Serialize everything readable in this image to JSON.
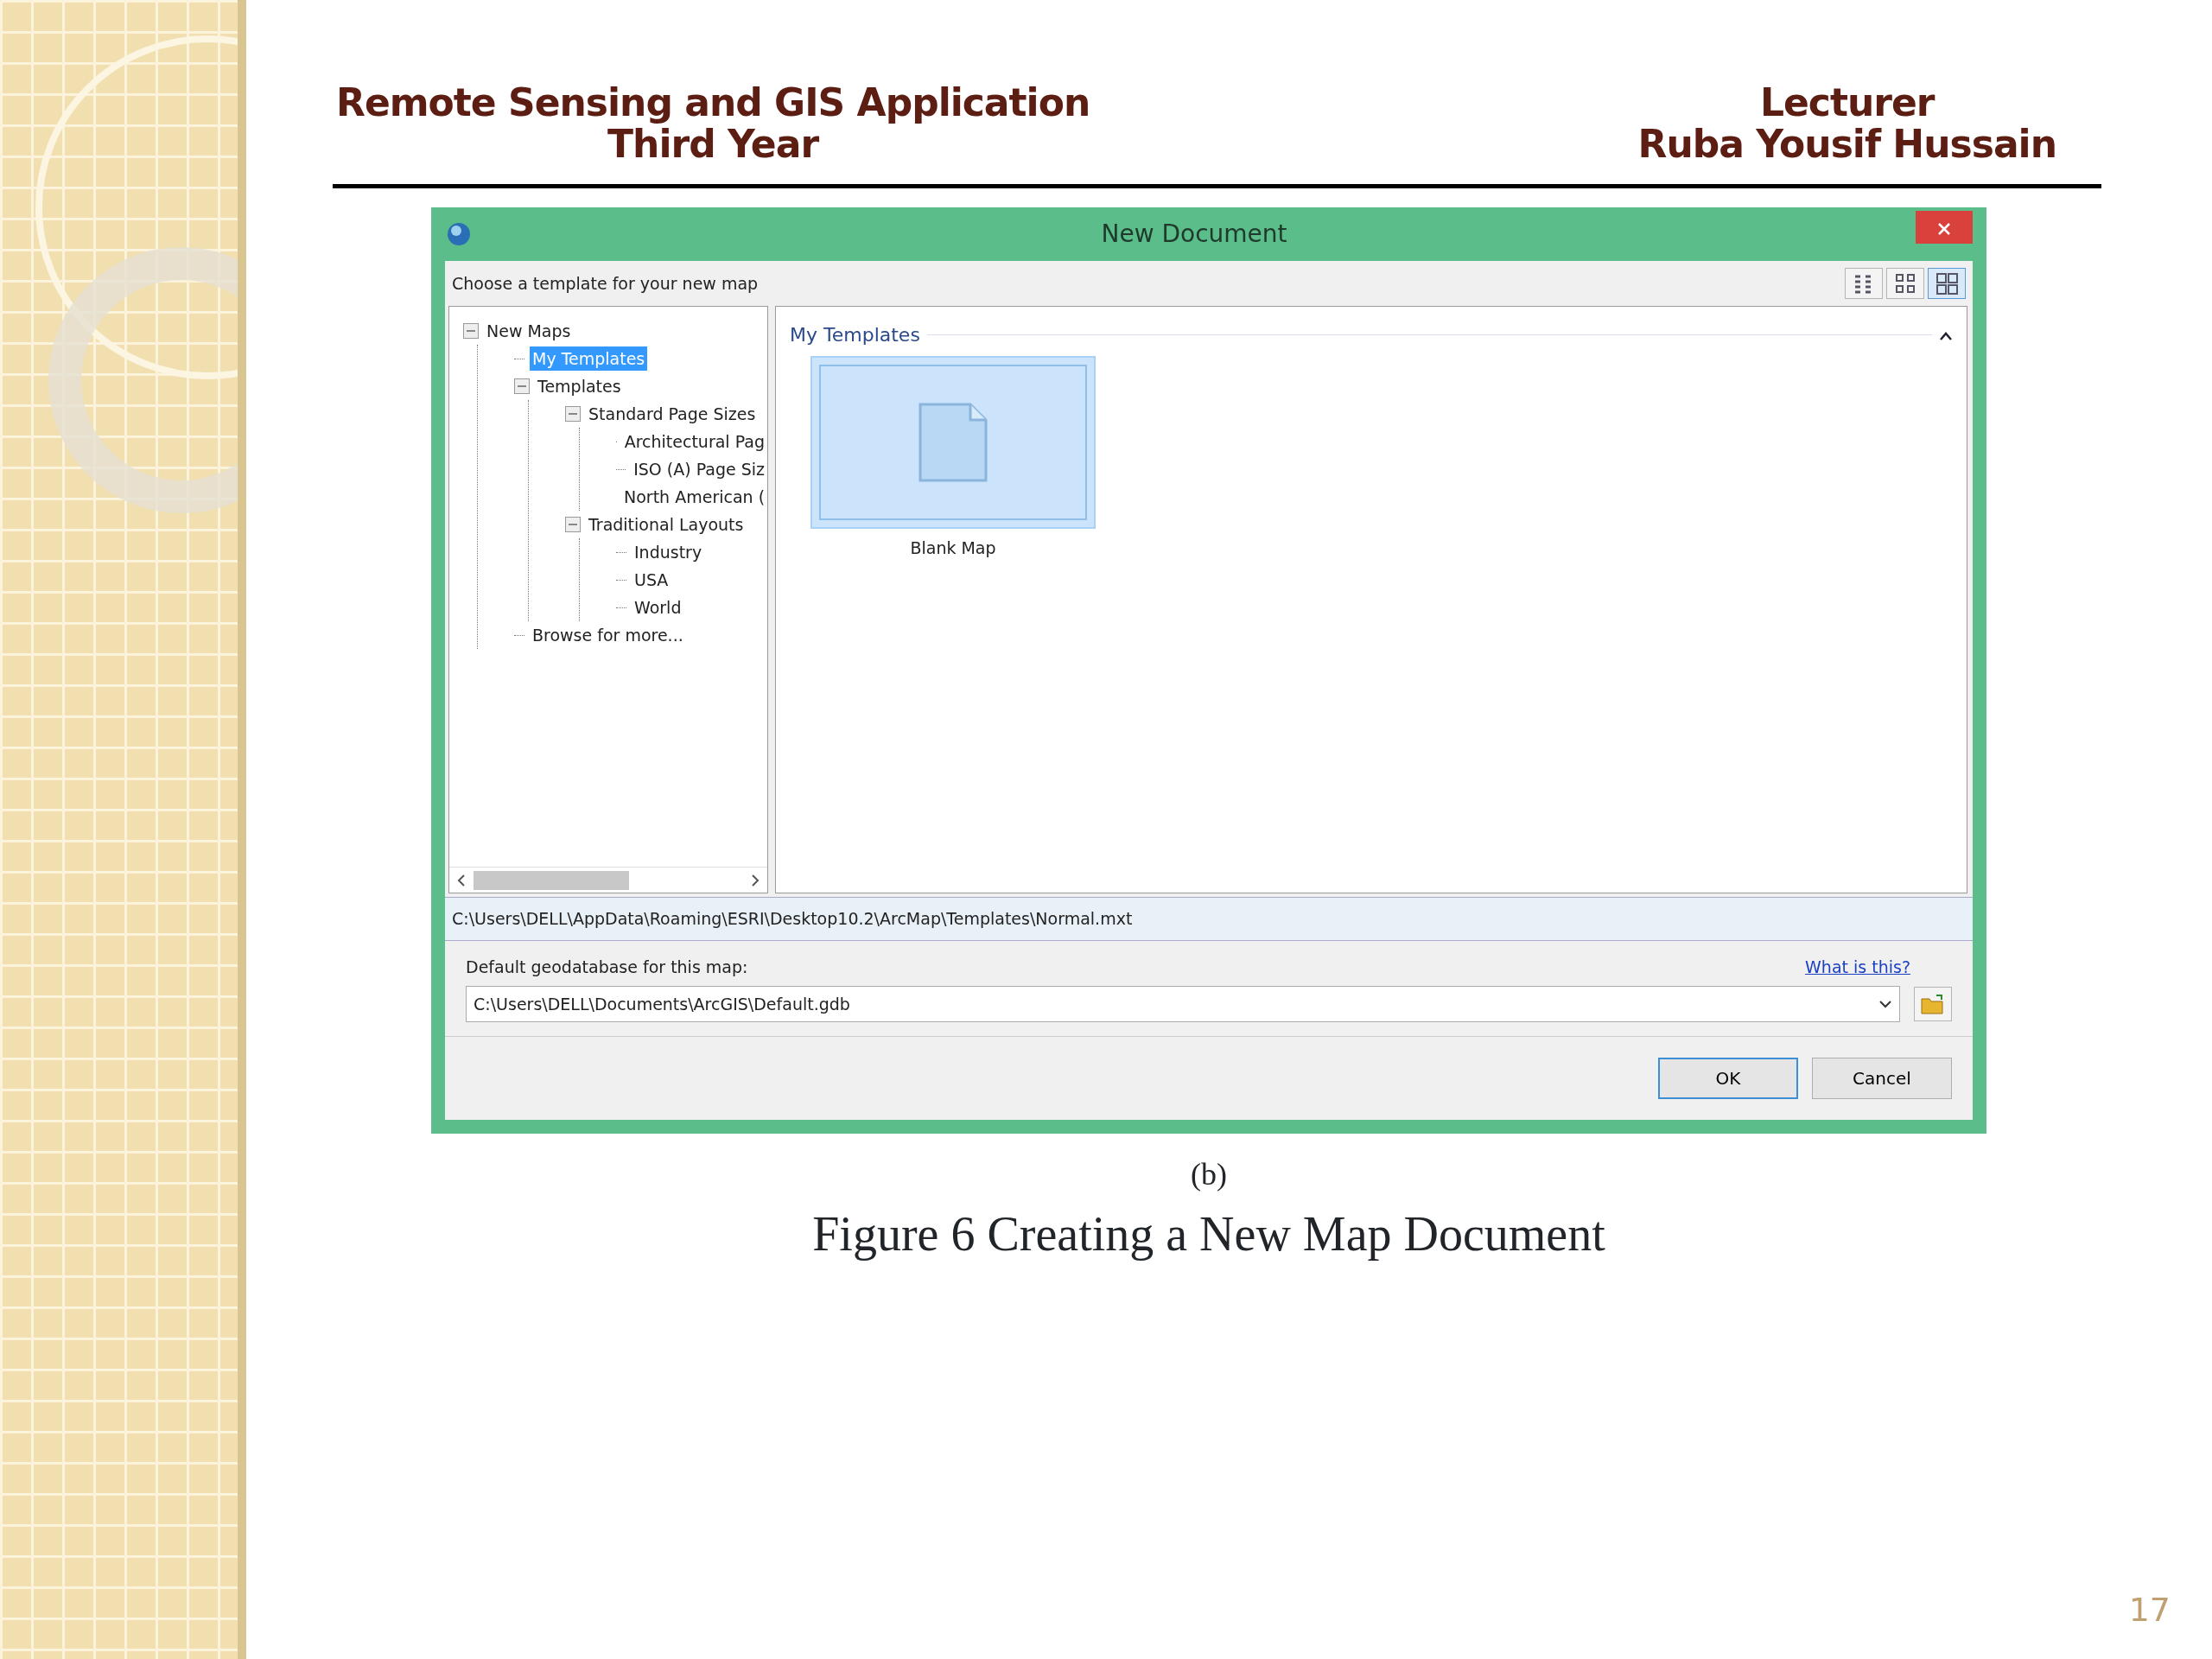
{
  "header": {
    "left_lines": [
      "Remote Sensing and GIS Application",
      "Third Year"
    ],
    "right_lines": [
      "Lecturer",
      "Ruba Yousif Hussain"
    ]
  },
  "dialog": {
    "title": "New Document",
    "prompt": "Choose a template for your new map",
    "view_buttons": [
      {
        "selected": false
      },
      {
        "selected": false
      },
      {
        "selected": true
      }
    ],
    "tree": [
      {
        "label": "New Maps",
        "expanded": true,
        "selected": false,
        "children": [
          {
            "label": "My Templates",
            "selected": true
          },
          {
            "label": "Templates",
            "expanded": true,
            "selected": false,
            "children": [
              {
                "label": "Standard Page Sizes",
                "expanded": true,
                "selected": false,
                "children": [
                  {
                    "label": "Architectural Pag",
                    "selected": false
                  },
                  {
                    "label": "ISO (A) Page Siz",
                    "selected": false
                  },
                  {
                    "label": "North American (",
                    "selected": false
                  }
                ]
              },
              {
                "label": "Traditional Layouts",
                "expanded": true,
                "selected": false,
                "children": [
                  {
                    "label": "Industry",
                    "selected": false
                  },
                  {
                    "label": "USA",
                    "selected": false
                  },
                  {
                    "label": "World",
                    "selected": false
                  }
                ]
              }
            ]
          },
          {
            "label": "Browse for more...",
            "selected": false
          }
        ]
      }
    ],
    "group": {
      "title": "My Templates",
      "expanded": true,
      "items": [
        {
          "label": "Blank Map",
          "selected": true
        }
      ]
    },
    "template_path": "C:\\Users\\DELL\\AppData\\Roaming\\ESRI\\Desktop10.2\\ArcMap\\Templates\\Normal.mxt",
    "geodatabase_label": "Default geodatabase for this map:",
    "help_link": "What is this?",
    "geodatabase_value": "C:\\Users\\DELL\\Documents\\ArcGIS\\Default.gdb",
    "buttons": [
      "OK",
      "Cancel"
    ]
  },
  "caption": {
    "sub": "(b)",
    "title": "Figure 6  Creating a New Map Document"
  },
  "page_number": "17"
}
